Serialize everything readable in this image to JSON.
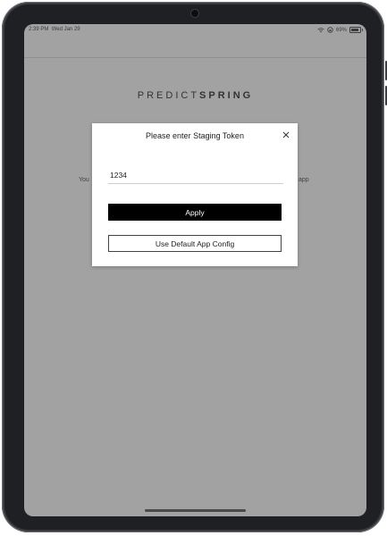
{
  "statusbar": {
    "time": "2:39 PM",
    "date": "Wed Jan 29",
    "battery": "69%",
    "battery_level": 0.69,
    "icons": [
      "wifi-icon",
      "lock-rotation-icon",
      "battery-icon"
    ]
  },
  "brand": {
    "part1": "PREDICT",
    "part2": "SPRING"
  },
  "background": {
    "left_fragment": "You",
    "right_fragment": "app"
  },
  "dialog": {
    "title": "Please enter Staging Token",
    "token_value": "1234",
    "apply_label": "Apply",
    "default_label": "Use Default App Config",
    "close_icon": "close-icon"
  },
  "colors": {
    "overlay": "#a2a2a2",
    "primary_button": "#000000",
    "device_frame": "#1f2023"
  }
}
